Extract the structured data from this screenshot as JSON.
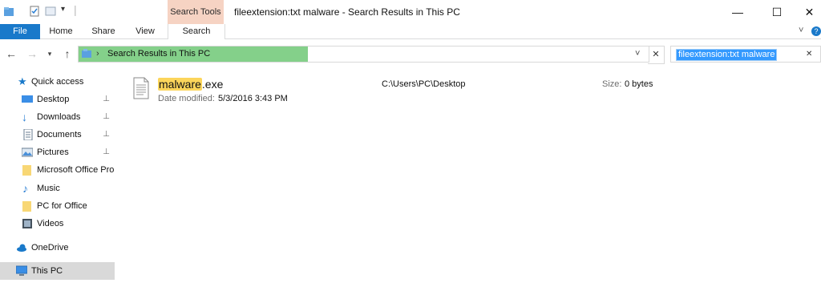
{
  "window": {
    "title": "fileextension:txt malware - Search Results in This PC",
    "contextual_tab": "Search Tools",
    "controls": {
      "minimize": "—",
      "maximize": "☐",
      "close": "✕"
    }
  },
  "ribbon": {
    "tabs": [
      "File",
      "Home",
      "Share",
      "View",
      "Search"
    ],
    "collapse_icon": "˅",
    "help_icon": "?"
  },
  "address_bar": {
    "breadcrumb_separator": "›",
    "location": "Search Results in This PC",
    "dropdown_icon": "˅",
    "cancel_icon": "✕"
  },
  "search": {
    "query": "fileextension:txt malware",
    "clear_icon": "✕"
  },
  "nav_pane": {
    "quick_access": "Quick access",
    "items": [
      {
        "label": "Desktop",
        "pinned": true
      },
      {
        "label": "Downloads",
        "pinned": true
      },
      {
        "label": "Documents",
        "pinned": true
      },
      {
        "label": "Pictures",
        "pinned": true
      },
      {
        "label": "Microsoft Office Pro",
        "pinned": false
      },
      {
        "label": "Music",
        "pinned": false
      },
      {
        "label": "PC for Office",
        "pinned": false
      },
      {
        "label": "Videos",
        "pinned": false
      }
    ],
    "onedrive": "OneDrive",
    "this_pc": "This PC",
    "pin_glyph": "📌"
  },
  "results": [
    {
      "name_highlight": "malware",
      "name_rest": ".exe",
      "date_label": "Date modified:",
      "date_value": "5/3/2016 3:43 PM",
      "path": "C:\\Users\\PC\\Desktop",
      "size_label": "Size:",
      "size_value": "0 bytes"
    }
  ],
  "colors": {
    "file_tab": "#1979ca",
    "search_tools_tab": "#f6d3c3",
    "progress": "#84d08a",
    "selection": "#d9d9d9",
    "highlight": "#fcd55b"
  }
}
